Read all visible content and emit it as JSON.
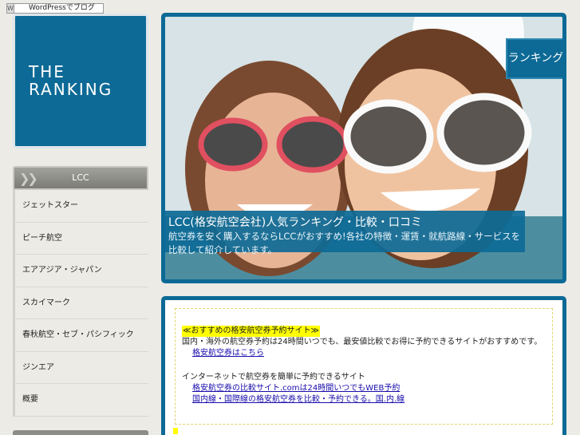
{
  "wp_badge": {
    "icon": "wordpress-icon",
    "text": "WordPressでブログ"
  },
  "logo": {
    "line1": "THE",
    "line2": "RANKING"
  },
  "nav": {
    "header": "LCC",
    "items": [
      {
        "label": "ジェットスター"
      },
      {
        "label": "ピーチ航空"
      },
      {
        "label": "エアアジア・ジャパン"
      },
      {
        "label": "スカイマーク"
      },
      {
        "label": "春秋航空・セブ・パシフィック"
      },
      {
        "label": "ジンエア"
      },
      {
        "label": "概要"
      }
    ]
  },
  "hero": {
    "badge": "ランキング",
    "caption_line1": "LCC(格安航空会社)人気ランキング・比較・口コミ",
    "caption_line2": "航空券を安く購入するならLCCがおすすめ!各社の特徴・運賃・就航路線・サービスを比較して紹介しています。"
  },
  "content": {
    "highlight": "≪おすすめの格安航空券予約サイト≫",
    "line1": "国内・海外の航空券予約は24時間いつでも、最安値比較でお得に予約できるサイトがおすすめです。",
    "link1": "格安航空券はこちら",
    "line2": "インターネットで航空券を簡単に予約できるサイト",
    "link2": "格安航空券の比較サイト.comは24時間いつでもWEB予約",
    "link3": "国内線・国際線の格安航空券を比較・予約できる。国.内.線"
  }
}
